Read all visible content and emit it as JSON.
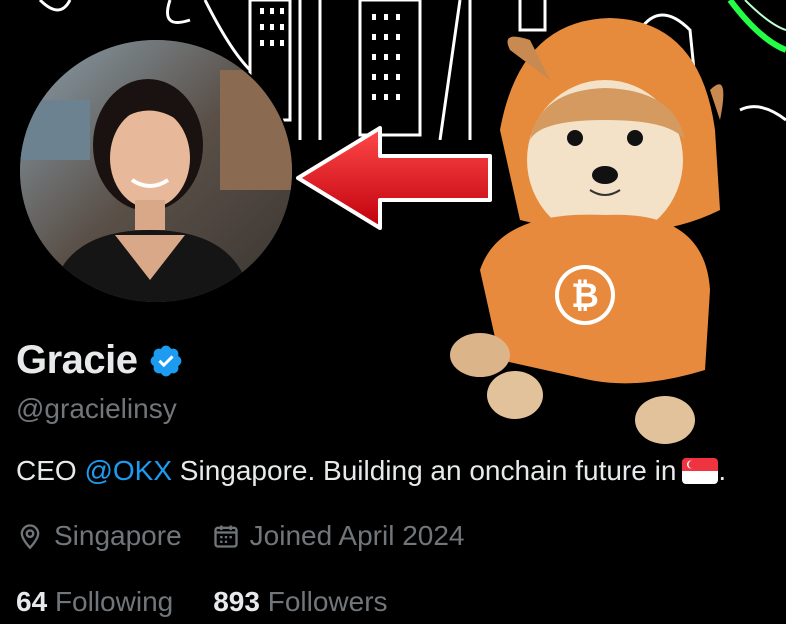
{
  "profile": {
    "name": "Gracie",
    "handle": "@gracielinsy",
    "bio": {
      "prefix": "CEO ",
      "mention": "@OKX",
      "suffix": " Singapore. Building an onchain future in",
      "end": "."
    },
    "location": "Singapore",
    "joined": "Joined April 2024",
    "following_count": "64",
    "following_label": "Following",
    "followers_count": "893",
    "followers_label": "Followers"
  },
  "icons": {
    "verified": "verified-badge-icon",
    "location": "location-pin-icon",
    "calendar": "calendar-icon",
    "flag": "singapore-flag-icon"
  },
  "colors": {
    "background": "#000000",
    "text_primary": "#e7e9ea",
    "text_secondary": "#71767b",
    "link": "#1d9bf0",
    "verified": "#1d9bf0",
    "arrow": "#e0141e"
  }
}
